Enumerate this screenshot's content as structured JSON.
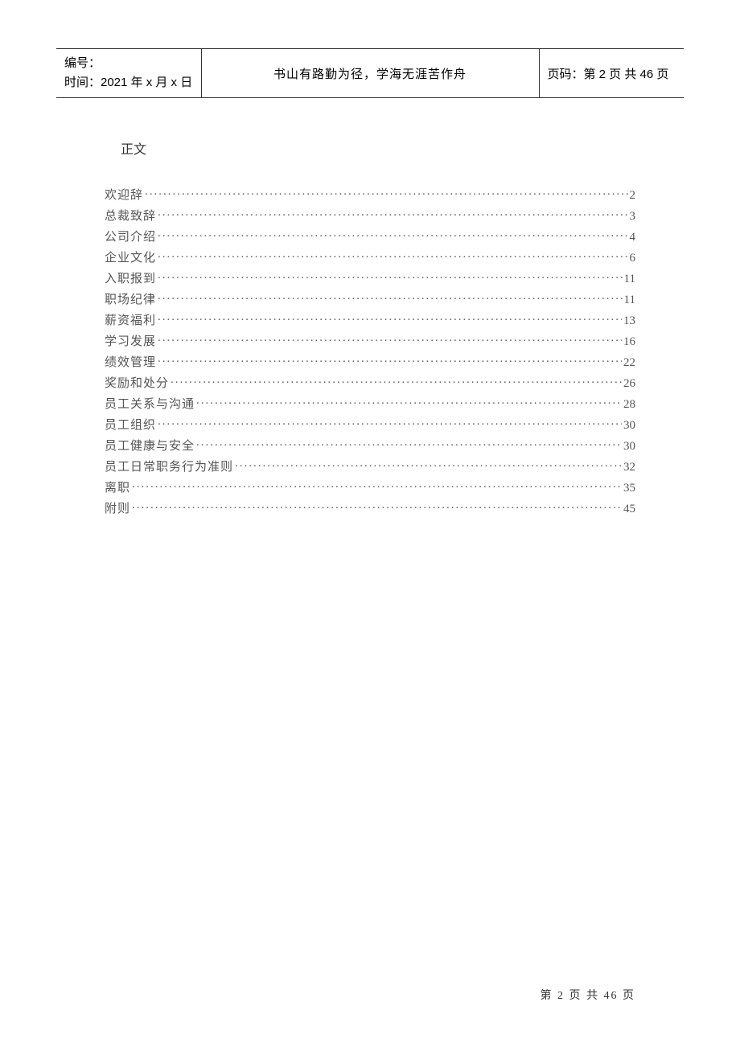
{
  "header": {
    "left_line1": "编号：",
    "left_line2": "时间：2021 年 x 月 x 日",
    "center": "书山有路勤为径，学海无涯苦作舟",
    "right": "页码：第 2 页  共 46 页"
  },
  "section_title": "正文",
  "toc": [
    {
      "label": "欢迎辞",
      "page": "2"
    },
    {
      "label": "总裁致辞",
      "page": "3"
    },
    {
      "label": "公司介绍",
      "page": "4"
    },
    {
      "label": "企业文化",
      "page": "6"
    },
    {
      "label": "入职报到",
      "page": "11"
    },
    {
      "label": "职场纪律",
      "page": "11"
    },
    {
      "label": "薪资福利",
      "page": "13"
    },
    {
      "label": "学习发展",
      "page": "16"
    },
    {
      "label": "绩效管理",
      "page": "22"
    },
    {
      "label": "奖励和处分",
      "page": "26"
    },
    {
      "label": "员工关系与沟通",
      "page": "28"
    },
    {
      "label": "员工组织",
      "page": "30"
    },
    {
      "label": "员工健康与安全",
      "page": "30"
    },
    {
      "label": "员工日常职务行为准则",
      "page": "32"
    },
    {
      "label": "离职",
      "page": "35"
    },
    {
      "label": "附则",
      "page": "45"
    }
  ],
  "footer": "第 2 页 共 46 页"
}
